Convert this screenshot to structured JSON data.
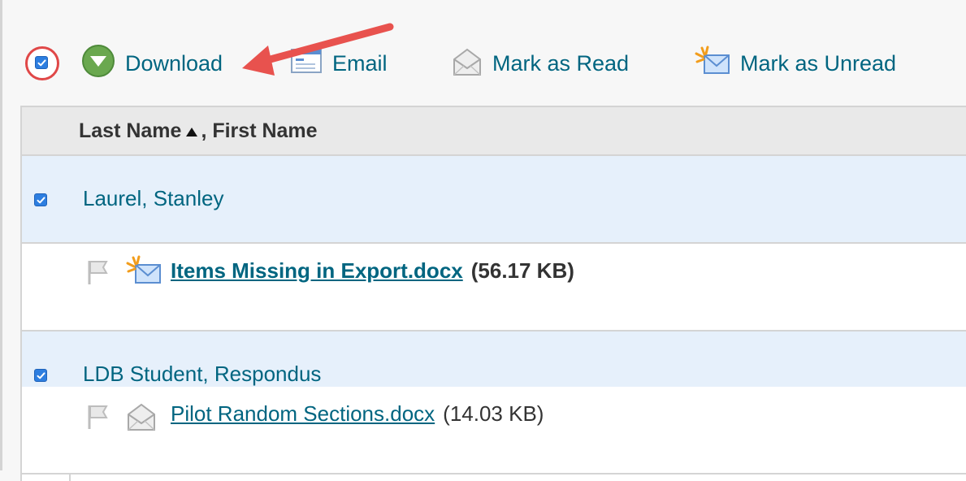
{
  "toolbar": {
    "download_label": "Download",
    "email_label": "Email",
    "mark_read_label": "Mark as Read",
    "mark_unread_label": "Mark as Unread"
  },
  "table": {
    "header": {
      "last_name": "Last Name",
      "first_name": ", First Name"
    },
    "groups": [
      {
        "name": "Laurel, Stanley",
        "checked": true,
        "file": {
          "name": "Items Missing in Export.docx",
          "size": "(56.17 KB)",
          "unread": true
        }
      },
      {
        "name": "LDB Student, Respondus",
        "checked": true,
        "file": {
          "name": "Pilot Random Sections.docx",
          "size": "(14.03 KB)",
          "unread": false
        }
      }
    ]
  },
  "colors": {
    "link": "#006580",
    "checkbox": "#2d7ee0",
    "highlight": "#e04848",
    "row_bg": "#e6f0fb"
  }
}
